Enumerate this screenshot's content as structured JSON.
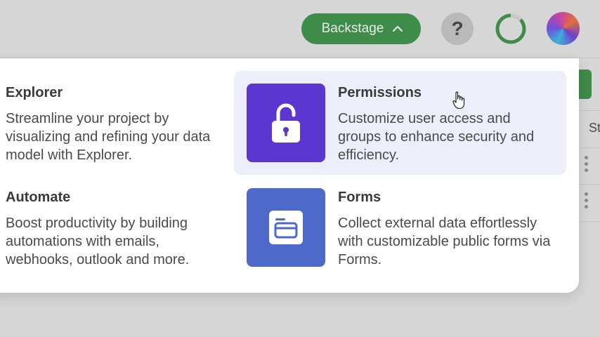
{
  "topbar": {
    "backstage_label": "Backstage",
    "help_label": "?"
  },
  "background": {
    "partial_column_text": "St"
  },
  "menu": {
    "items": [
      {
        "title": "Explorer",
        "description": "Streamline your project by visualizing and refining your data model with Explorer."
      },
      {
        "title": "Permissions",
        "description": "Customize user access and groups to enhance security and efficiency.",
        "icon": "unlock-icon",
        "tile_color": "#5b36d1",
        "highlighted": true
      },
      {
        "title": "Automate",
        "description": "Boost productivity by building automations with emails, webhooks, outlook and more."
      },
      {
        "title": "Forms",
        "description": "Collect external data effortlessly with customizable public forms via Forms.",
        "icon": "form-icon",
        "tile_color": "#4d6acb"
      }
    ]
  },
  "colors": {
    "accent_green": "#3f8b4a",
    "highlight_bg": "#eceffa"
  }
}
